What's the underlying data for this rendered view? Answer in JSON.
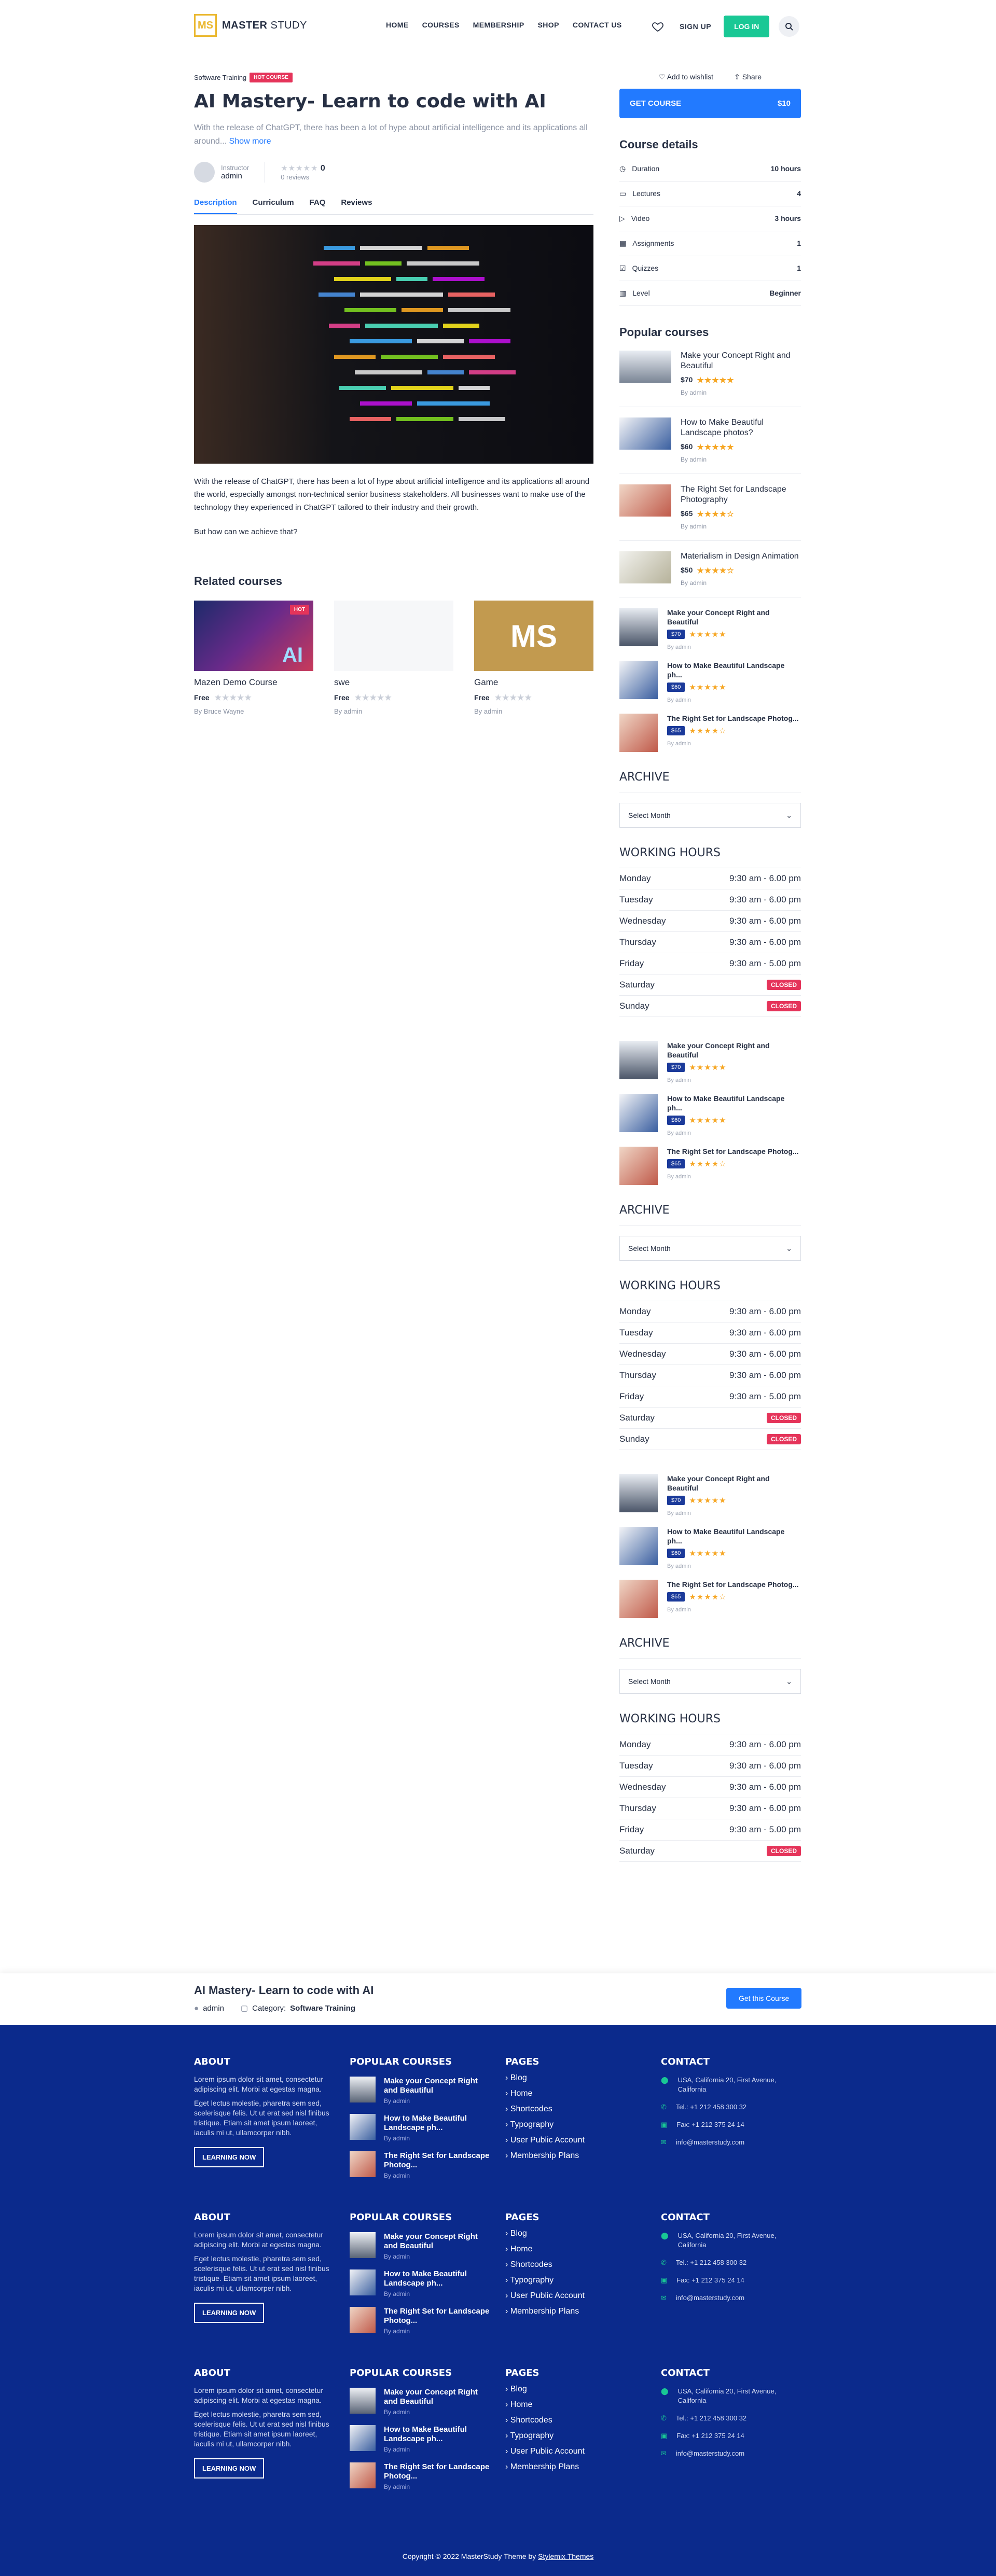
{
  "header": {
    "logo_mark": "MS",
    "logo_text_bold": "MASTER",
    "logo_text": "STUDY",
    "nav": [
      "HOME",
      "COURSES",
      "MEMBERSHIP",
      "SHOP",
      "CONTACT US"
    ],
    "signup": "SIGN UP",
    "login": "LOG IN"
  },
  "course": {
    "category": "Software Training",
    "hot": "HOT COURSE",
    "title": "AI Mastery- Learn to code with AI",
    "excerpt": "With the release of ChatGPT, there has been a lot of hype about artificial intelligence and its applications all around...",
    "show_more": "Show more",
    "instructor_label": "Instructor",
    "instructor": "admin",
    "rating": "0",
    "reviews": "0 reviews",
    "tabs": [
      "Description",
      "Curriculum",
      "FAQ",
      "Reviews"
    ],
    "description": "With the release of ChatGPT, there has been a lot of hype about artificial intelligence and its applications all around the world, especially amongst non-technical senior business stakeholders. All businesses want to make use of the technology they experienced in ChatGPT tailored to their industry and their growth.",
    "question": "But how can we achieve that?"
  },
  "related": {
    "heading": "Related courses",
    "items": [
      {
        "title": "Mazen Demo Course",
        "price": "Free",
        "by": "By Bruce Wayne",
        "badge": "HOT"
      },
      {
        "title": "swe",
        "price": "Free",
        "by": "By admin"
      },
      {
        "title": "Game",
        "price": "Free",
        "by": "By admin"
      }
    ]
  },
  "sidebar": {
    "wishlist": "Add to wishlist",
    "share": "Share",
    "get_course": "GET COURSE",
    "get_price": "$10",
    "details_heading": "Course details",
    "details": [
      {
        "k": "Duration",
        "v": "10 hours"
      },
      {
        "k": "Lectures",
        "v": "4"
      },
      {
        "k": "Video",
        "v": "3 hours"
      },
      {
        "k": "Assignments",
        "v": "1"
      },
      {
        "k": "Quizzes",
        "v": "1"
      },
      {
        "k": "Level",
        "v": "Beginner"
      }
    ],
    "popular_heading": "Popular courses",
    "popular": [
      {
        "title": "Make your Concept Right and Beautiful",
        "price": "$70",
        "by": "By admin"
      },
      {
        "title": "How to Make Beautiful Landscape photos?",
        "price": "$60",
        "by": "By admin"
      },
      {
        "title": "The Right Set for Landscape Photography",
        "price": "$65",
        "by": "By admin"
      },
      {
        "title": "Materialism in Design Animation",
        "price": "$50",
        "by": "By admin"
      }
    ],
    "widget_courses": [
      {
        "title": "Make your Concept Right and Beautiful",
        "price": "$70",
        "by": "By admin"
      },
      {
        "title": "How to Make Beautiful Landscape ph...",
        "price": "$60",
        "by": "By admin"
      },
      {
        "title": "The Right Set for Landscape Photog...",
        "price": "$65",
        "by": "By admin"
      }
    ],
    "archive_heading": "ARCHIVE",
    "select_month": "Select Month",
    "hours_heading": "WORKING HOURS",
    "hours": [
      {
        "d": "Monday",
        "h": "9:30 am - 6.00 pm"
      },
      {
        "d": "Tuesday",
        "h": "9:30 am - 6.00 pm"
      },
      {
        "d": "Wednesday",
        "h": "9:30 am - 6.00 pm"
      },
      {
        "d": "Thursday",
        "h": "9:30 am - 6.00 pm"
      },
      {
        "d": "Friday",
        "h": "9:30 am - 5.00 pm"
      },
      {
        "d": "Saturday",
        "h": "CLOSED"
      },
      {
        "d": "Sunday",
        "h": "CLOSED"
      }
    ]
  },
  "sticky": {
    "title": "AI Mastery- Learn to code with AI",
    "author": "admin",
    "category_label": "Category:",
    "category": "Software Training",
    "button": "Get this Course"
  },
  "footer": {
    "about_heading": "ABOUT",
    "about_p1": "Lorem ipsum dolor sit amet, consectetur adipiscing elit. Morbi at egestas magna.",
    "about_p2": "Eget lectus molestie, pharetra sem sed, scelerisque felis. Ut ut erat sed nisl finibus tristique. Etiam sit amet ipsum laoreet, iaculis mi ut, ullamcorper nibh.",
    "learn_btn": "LEARNING NOW",
    "popular_heading": "POPULAR COURSES",
    "popular": [
      {
        "title": "Make your Concept Right and Beautiful",
        "by": "By admin"
      },
      {
        "title": "How to Make Beautiful Landscape ph...",
        "by": "By admin"
      },
      {
        "title": "The Right Set for Landscape Photog...",
        "by": "By admin"
      }
    ],
    "pages_heading": "PAGES",
    "pages": [
      "Blog",
      "Home",
      "Shortcodes",
      "Typography",
      "User Public Account",
      "Membership Plans"
    ],
    "contact_heading": "CONTACT",
    "address": "USA, California 20, First Avenue, California",
    "tel": "Tel.: +1 212 458 300 32",
    "fax": "Fax: +1 212 375 24 14",
    "email": "info@masterstudy.com",
    "copyright": "Copyright © 2022 MasterStudy Theme by",
    "copyright_link": "Stylemix Themes"
  },
  "colors": {
    "accent": "#227aff",
    "green": "#19c895",
    "footer": "#0b2a8c",
    "hot": "#e5345a",
    "star": "#f6a623",
    "logo": "#eab830"
  }
}
